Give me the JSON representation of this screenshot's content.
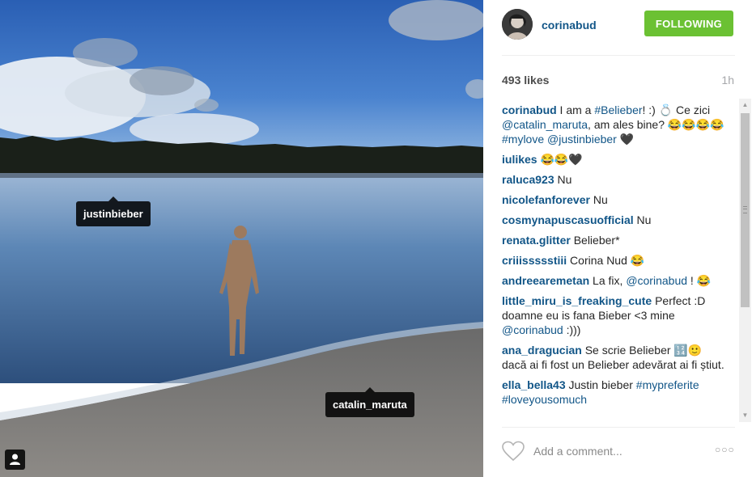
{
  "photo": {
    "tags": [
      "justinbieber",
      "catalin_maruta"
    ]
  },
  "header": {
    "username": "corinabud",
    "follow_label": "FOLLOWING"
  },
  "stats": {
    "likes": "493 likes",
    "time": "1h"
  },
  "comments": [
    {
      "user": "corinabud",
      "parts": [
        {
          "t": " I am a "
        },
        {
          "t": "#Belieber",
          "link": true
        },
        {
          "t": "! :) 💍 Ce zici "
        },
        {
          "t": "@catalin_maruta",
          "link": true
        },
        {
          "t": ", am ales bine? 😂😂😂😂 "
        },
        {
          "t": "#mylove",
          "link": true
        },
        {
          "t": " "
        },
        {
          "t": "@justinbieber",
          "link": true
        },
        {
          "t": " 🖤"
        }
      ]
    },
    {
      "user": "iulikes",
      "parts": [
        {
          "t": " 😂😂🖤"
        }
      ]
    },
    {
      "user": "raluca923",
      "parts": [
        {
          "t": " Nu"
        }
      ]
    },
    {
      "user": "nicolefanforever",
      "parts": [
        {
          "t": " Nu"
        }
      ]
    },
    {
      "user": "cosmynapuscasuofficial",
      "parts": [
        {
          "t": " Nu"
        }
      ]
    },
    {
      "user": "renata.glitter",
      "parts": [
        {
          "t": " Belieber*"
        }
      ]
    },
    {
      "user": "criiissssstiii",
      "parts": [
        {
          "t": " Corina Nud 😂"
        }
      ]
    },
    {
      "user": "andreearemetan",
      "parts": [
        {
          "t": " La fix, "
        },
        {
          "t": "@corinabud",
          "link": true
        },
        {
          "t": " ! 😂"
        }
      ]
    },
    {
      "user": "little_miru_is_freaking_cute",
      "parts": [
        {
          "t": " Perfect :D doamne eu is fana Bieber <3 mine "
        },
        {
          "t": "@corinabud",
          "link": true
        },
        {
          "t": " :)))"
        }
      ]
    },
    {
      "user": "ana_dragucian",
      "parts": [
        {
          "t": " Se scrie Belieber 🔢🙂 dacă ai fi fost un Belieber adevărat ai fi știut."
        }
      ]
    },
    {
      "user": "ella_bella43",
      "parts": [
        {
          "t": " Justin bieber "
        },
        {
          "t": "#mypreferite",
          "link": true
        },
        {
          "t": " "
        },
        {
          "t": "#loveyousomuch",
          "link": true
        }
      ]
    }
  ],
  "footer": {
    "comment_placeholder": "Add a comment...",
    "more_label": "○○○"
  },
  "colors": {
    "link": "#125688",
    "follow_bg": "#6bc133"
  }
}
